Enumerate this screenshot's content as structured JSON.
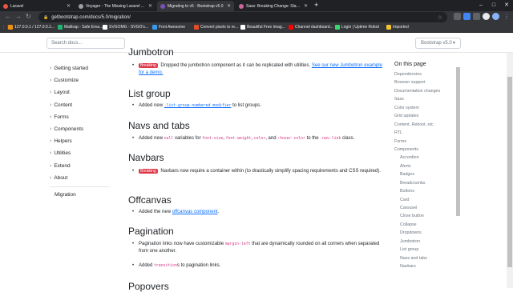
{
  "browser": {
    "tabs": [
      {
        "label": "Laravel",
        "color": "#f05340",
        "active": false
      },
      {
        "label": "Voyager - The Missing Laravel Adm",
        "color": "#9aa0a6",
        "active": false
      },
      {
        "label": "Migrating to v5 · Bootstrap v5.0",
        "color": "#7952b3",
        "active": true
      },
      {
        "label": "Sass: Breaking Change: Slash as D",
        "color": "#cd6799",
        "active": false
      }
    ],
    "new_tab": "+",
    "url": "getbootstrap.com/docs/5.0/migration/",
    "bookmarks": [
      {
        "label": "127.0.0.1 / 127.0.0.1...",
        "color": "#f29111"
      },
      {
        "label": "Mailtrap - Safe Ema...",
        "color": "#22b573"
      },
      {
        "label": "SVGOMG - SVGO's...",
        "color": "#ffffff"
      },
      {
        "label": "Font Awesome",
        "color": "#339af0"
      },
      {
        "label": "Convert pixels to re...",
        "color": "#e34c26"
      },
      {
        "label": "Beautiful Free Imag...",
        "color": "#ffffff"
      },
      {
        "label": "Channel dashboard...",
        "color": "#ff0000"
      },
      {
        "label": "Login | Uptime Robot",
        "color": "#3bd671"
      },
      {
        "label": "Imported",
        "color": "#f4c430"
      }
    ]
  },
  "header": {
    "search_placeholder": "Search docs...",
    "version": "Bootstrap v5.0"
  },
  "sidebar": {
    "items": [
      "Getting started",
      "Customize",
      "Layout",
      "Content",
      "Forms",
      "Components",
      "Helpers",
      "Utilities",
      "Extend",
      "About"
    ],
    "active": "Migration"
  },
  "content": {
    "jumbotron": {
      "heading": "Jumbotron",
      "badge": "Breaking",
      "text": "Dropped the jumbotron component as it can be replicated with utilities.",
      "link": "See our new Jumbotron example for a demo."
    },
    "list_group": {
      "heading": "List group",
      "pre": "Added new",
      "code": ".list-group-numbered modifier",
      "post": "to list groups."
    },
    "navs": {
      "heading": "Navs and tabs",
      "pre": "Added new",
      "code1": "null",
      "mid": "variables for",
      "code2": "font-size",
      "code3": "font-weight",
      "code4": "color",
      "and": ", and",
      "code5": ":hover color",
      "to": "to the",
      "code6": ".nav-link",
      "post": "class."
    },
    "navbars": {
      "heading": "Navbars",
      "badge": "Breaking",
      "text": "Navbars now require a container within (to drastically simplify spacing requirements and CSS required)."
    },
    "offcanvas": {
      "heading": "Offcanvas",
      "pre": "Added the new",
      "link": "offcanvas component",
      "post": "."
    },
    "pagination": {
      "heading": "Pagination",
      "b1_pre": "Pagination links now have customizable",
      "b1_code": "margin-left",
      "b1_post": "that are dynamically rounded on all corners when separated from one another.",
      "b2_pre": "Added",
      "b2_code": "transition",
      "b2_post": "s to pagination links."
    },
    "popovers": {
      "heading": "Popovers"
    }
  },
  "toc": {
    "title": "On this page",
    "items": [
      {
        "label": "Dependencies",
        "sub": false
      },
      {
        "label": "Browser support",
        "sub": false
      },
      {
        "label": "Documentation changes",
        "sub": false
      },
      {
        "label": "Sass",
        "sub": false
      },
      {
        "label": "Color system",
        "sub": false
      },
      {
        "label": "Grid updates",
        "sub": false
      },
      {
        "label": "Content, Reboot, etc",
        "sub": false
      },
      {
        "label": "RTL",
        "sub": false
      },
      {
        "label": "Forms",
        "sub": false
      },
      {
        "label": "Components",
        "sub": false
      },
      {
        "label": "Accordion",
        "sub": true
      },
      {
        "label": "Alerts",
        "sub": true
      },
      {
        "label": "Badges",
        "sub": true
      },
      {
        "label": "Breadcrumbs",
        "sub": true
      },
      {
        "label": "Buttons",
        "sub": true
      },
      {
        "label": "Card",
        "sub": true
      },
      {
        "label": "Carousel",
        "sub": true
      },
      {
        "label": "Close button",
        "sub": true
      },
      {
        "label": "Collapse",
        "sub": true
      },
      {
        "label": "Dropdowns",
        "sub": true
      },
      {
        "label": "Jumbotron",
        "sub": true
      },
      {
        "label": "List group",
        "sub": true
      },
      {
        "label": "Navs and tabs",
        "sub": true
      },
      {
        "label": "Navbars",
        "sub": true
      }
    ]
  }
}
